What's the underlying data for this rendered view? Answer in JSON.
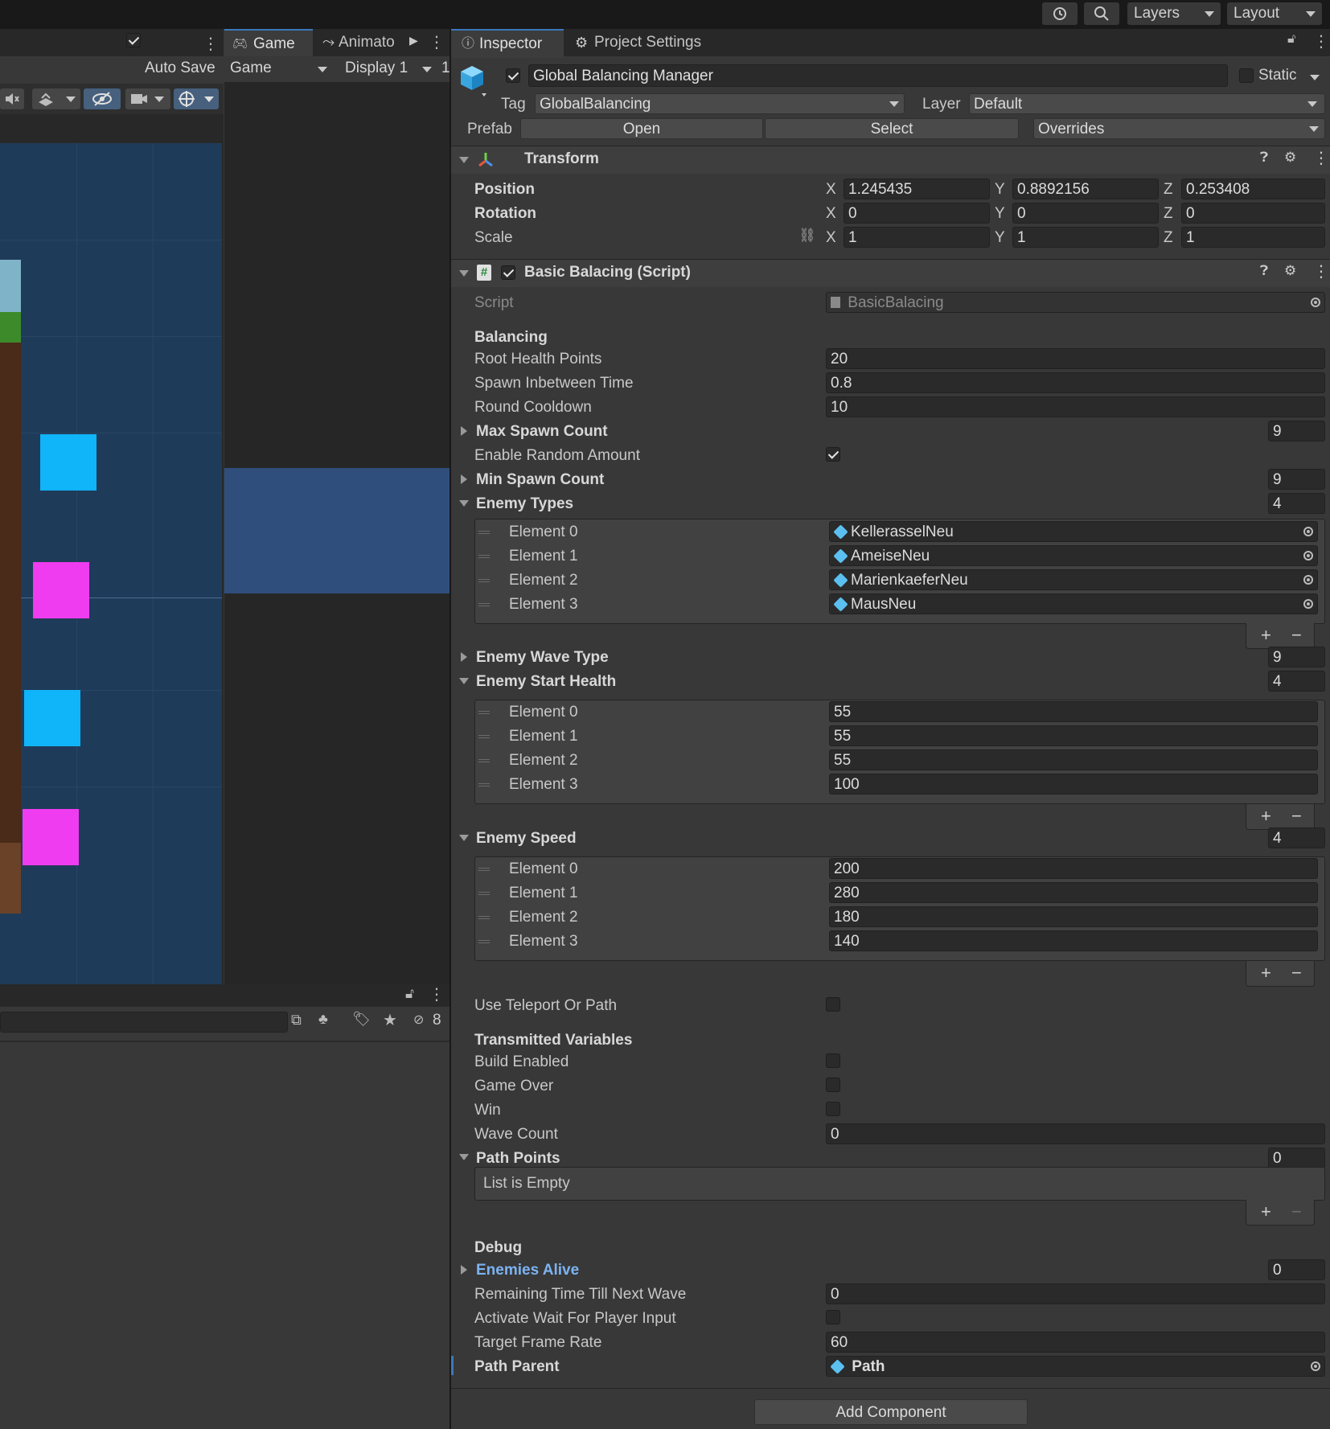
{
  "toolbar": {
    "layers_label": "Layers",
    "layout_label": "Layout",
    "history_icon": "history-icon",
    "search_icon": "search-icon"
  },
  "scene": {
    "auto_save_label": "Auto Save",
    "squares": [
      {
        "color": "#10b4f8"
      },
      {
        "color": "#f03cf0"
      },
      {
        "color": "#10b4f8"
      },
      {
        "color": "#f03cf0"
      }
    ]
  },
  "game": {
    "tab_game": "Game",
    "tab_animator": "Animato",
    "view_select": "Game",
    "display_select": "Display 1",
    "extra": "1"
  },
  "project": {
    "hidden_count": "8"
  },
  "inspector": {
    "tab_inspector": "Inspector",
    "tab_project_settings": "Project Settings",
    "object_name": "Global Balancing Manager",
    "static_label": "Static",
    "tag_label": "Tag",
    "tag_value": "GlobalBalancing",
    "layer_label": "Layer",
    "layer_value": "Default",
    "prefab_label": "Prefab",
    "prefab_open": "Open",
    "prefab_select": "Select",
    "prefab_overrides": "Overrides",
    "transform": {
      "title": "Transform",
      "position_label": "Position",
      "rotation_label": "Rotation",
      "scale_label": "Scale",
      "axis_x": "X",
      "axis_y": "Y",
      "axis_z": "Z",
      "position": [
        "1.245435",
        "0.8892156",
        "0.253408"
      ],
      "rotation": [
        "0",
        "0",
        "0"
      ],
      "scale": [
        "1",
        "1",
        "1"
      ]
    },
    "script": {
      "title": "Basic Balacing (Script)",
      "script_label": "Script",
      "script_value": "BasicBalacing",
      "balancing_header": "Balancing",
      "root_health_label": "Root Health Points",
      "root_health_value": "20",
      "spawn_time_label": "Spawn Inbetween Time",
      "spawn_time_value": "0.8",
      "round_cooldown_label": "Round Cooldown",
      "round_cooldown_value": "10",
      "max_spawn_label": "Max Spawn Count",
      "max_spawn_value": "9",
      "enable_random_label": "Enable Random Amount",
      "min_spawn_label": "Min Spawn Count",
      "min_spawn_value": "9",
      "enemy_types_label": "Enemy Types",
      "enemy_types_count": "4",
      "enemy_types": [
        {
          "label": "Element 0",
          "value": "KellerasselNeu"
        },
        {
          "label": "Element 1",
          "value": "AmeiseNeu"
        },
        {
          "label": "Element 2",
          "value": "MarienkaeferNeu"
        },
        {
          "label": "Element 3",
          "value": "MausNeu"
        }
      ],
      "enemy_wave_label": "Enemy Wave Type",
      "enemy_wave_count": "9",
      "enemy_health_label": "Enemy Start Health",
      "enemy_health_count": "4",
      "enemy_health": [
        {
          "label": "Element 0",
          "value": "55"
        },
        {
          "label": "Element 1",
          "value": "55"
        },
        {
          "label": "Element 2",
          "value": "55"
        },
        {
          "label": "Element 3",
          "value": "100"
        }
      ],
      "enemy_speed_label": "Enemy Speed",
      "enemy_speed_count": "4",
      "enemy_speed": [
        {
          "label": "Element 0",
          "value": "200"
        },
        {
          "label": "Element 1",
          "value": "280"
        },
        {
          "label": "Element 2",
          "value": "180"
        },
        {
          "label": "Element 3",
          "value": "140"
        }
      ],
      "teleport_label": "Use Teleport Or Path",
      "transmitted_header": "Transmitted Variables",
      "build_enabled_label": "Build Enabled",
      "game_over_label": "Game Over",
      "win_label": "Win",
      "wave_count_label": "Wave Count",
      "wave_count_value": "0",
      "path_points_label": "Path Points",
      "path_points_count": "0",
      "list_empty": "List is Empty",
      "debug_header": "Debug",
      "enemies_alive_label": "Enemies Alive",
      "enemies_alive_value": "0",
      "remaining_time_label": "Remaining Time Till Next Wave",
      "remaining_time_value": "0",
      "wait_input_label": "Activate Wait For Player Input",
      "target_fps_label": "Target Frame Rate",
      "target_fps_value": "60",
      "path_parent_label": "Path Parent",
      "path_parent_value": "Path"
    },
    "add_component": "Add Component",
    "plus": "+",
    "minus": "−"
  }
}
